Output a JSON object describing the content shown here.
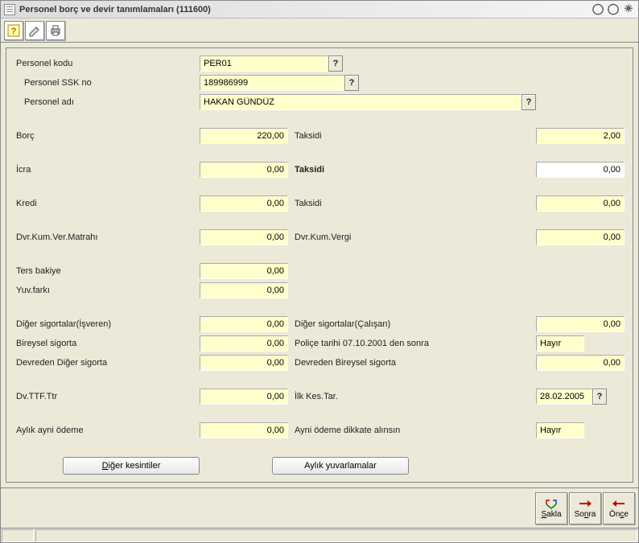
{
  "window": {
    "title": "Personel borç ve devir tanımlamaları (111600)"
  },
  "header": {
    "personel_kodu_label": "Personel kodu",
    "personel_kodu_value": "PER01",
    "personel_ssk_label": "Personel SSK no",
    "personel_ssk_value": "189986999",
    "personel_adi_label": "Personel adı",
    "personel_adi_value": "HAKAN GÜNDÜZ"
  },
  "rows": {
    "borc": {
      "label": "Borç",
      "value": "220,00",
      "taksidi_label": "Taksidi",
      "taksidi_value": "2,00"
    },
    "icra": {
      "label": "İcra",
      "value": "0,00",
      "taksidi_label": "Taksidi",
      "taksidi_value": "0,00"
    },
    "kredi": {
      "label": "Kredi",
      "value": "0,00",
      "taksidi_label": "Taksidi",
      "taksidi_value": "0,00"
    },
    "dvr_kum": {
      "label": "Dvr.Kum.Ver.Matrahı",
      "value": "0,00",
      "vergi_label": "Dvr.Kum.Vergi",
      "vergi_value": "0,00"
    },
    "ters_bakiye": {
      "label": "Ters bakiye",
      "value": "0,00"
    },
    "yuv_farki": {
      "label": "Yuv.farkı",
      "value": "0,00"
    },
    "diger_sig_isv": {
      "label": "Diğer sigortalar(İşveren)",
      "value": "0,00",
      "calisan_label": "Diğer sigortalar(Çalışan)",
      "calisan_value": "0,00"
    },
    "bireysel": {
      "label": "Bireysel sigorta",
      "value": "0,00",
      "police_label": "Poliçe tarihi 07.10.2001 den sonra",
      "police_value": "Hayır"
    },
    "devreden_diger": {
      "label": "Devreden Diğer sigorta",
      "value": "0,00",
      "bireysel_label": "Devreden Bireysel sigorta",
      "bireysel_value": "0,00"
    },
    "dv_ttf": {
      "label": "Dv.TTF.Ttr",
      "value": "0,00",
      "ilk_kes_label": "İlk Kes.Tar.",
      "ilk_kes_value": "28.02.2005"
    },
    "aylik_ayni": {
      "label": "Aylık ayni ödeme",
      "value": "0,00",
      "dikkate_label": "Ayni ödeme dikkate alınsın",
      "dikkate_value": "Hayır"
    }
  },
  "buttons": {
    "diger_kesintiler": "Diğer kesintiler",
    "aylik_yuvarlamalar": "Aylık yuvarlamalar"
  },
  "footer": {
    "sakla": "Sakla",
    "sonra": "Sonra",
    "once": "Önce"
  }
}
